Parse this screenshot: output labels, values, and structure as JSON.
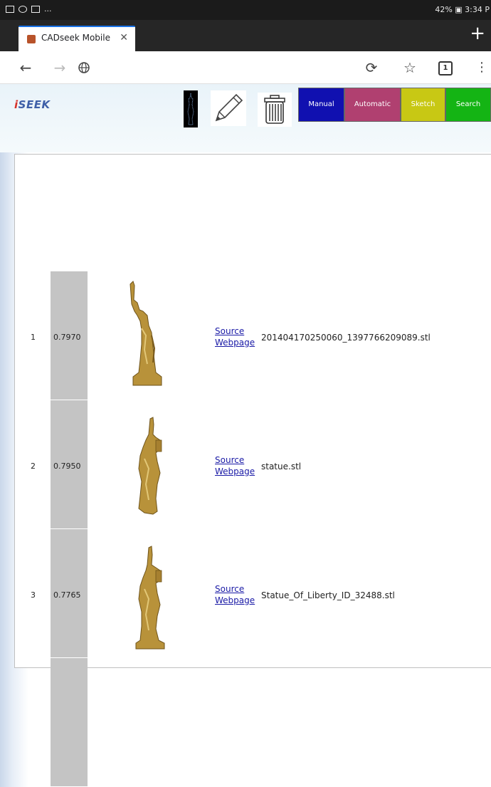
{
  "status_bar": {
    "right_text": "42% ▣ 3:34 P"
  },
  "tab": {
    "title": "CADseek Mobile",
    "close": "✕"
  },
  "new_tab": "+",
  "toolbar": {
    "tab_count": "1"
  },
  "app": {
    "logo_prefix": "i",
    "logo_rest": "SEEK",
    "modes": [
      {
        "label": "Manual",
        "color": "#1010b0"
      },
      {
        "label": "Automatic",
        "color": "#b04070"
      },
      {
        "label": "Sketch",
        "color": "#c8c814"
      },
      {
        "label": "Search",
        "color": "#14b414"
      }
    ]
  },
  "results": [
    {
      "rank": "1",
      "score": "0.7970",
      "link1": "Source",
      "link2": "Webpage",
      "filename": "201404170250060_1397766209089.stl"
    },
    {
      "rank": "2",
      "score": "0.7950",
      "link1": "Source",
      "link2": "Webpage",
      "filename": "statue.stl"
    },
    {
      "rank": "3",
      "score": "0.7765",
      "link1": "Source",
      "link2": "Webpage",
      "filename": "Statue_Of_Liberty_ID_32488.stl"
    }
  ],
  "colors": {
    "model_gold": "#b8923a",
    "score_bg": "#c4c4c4"
  }
}
